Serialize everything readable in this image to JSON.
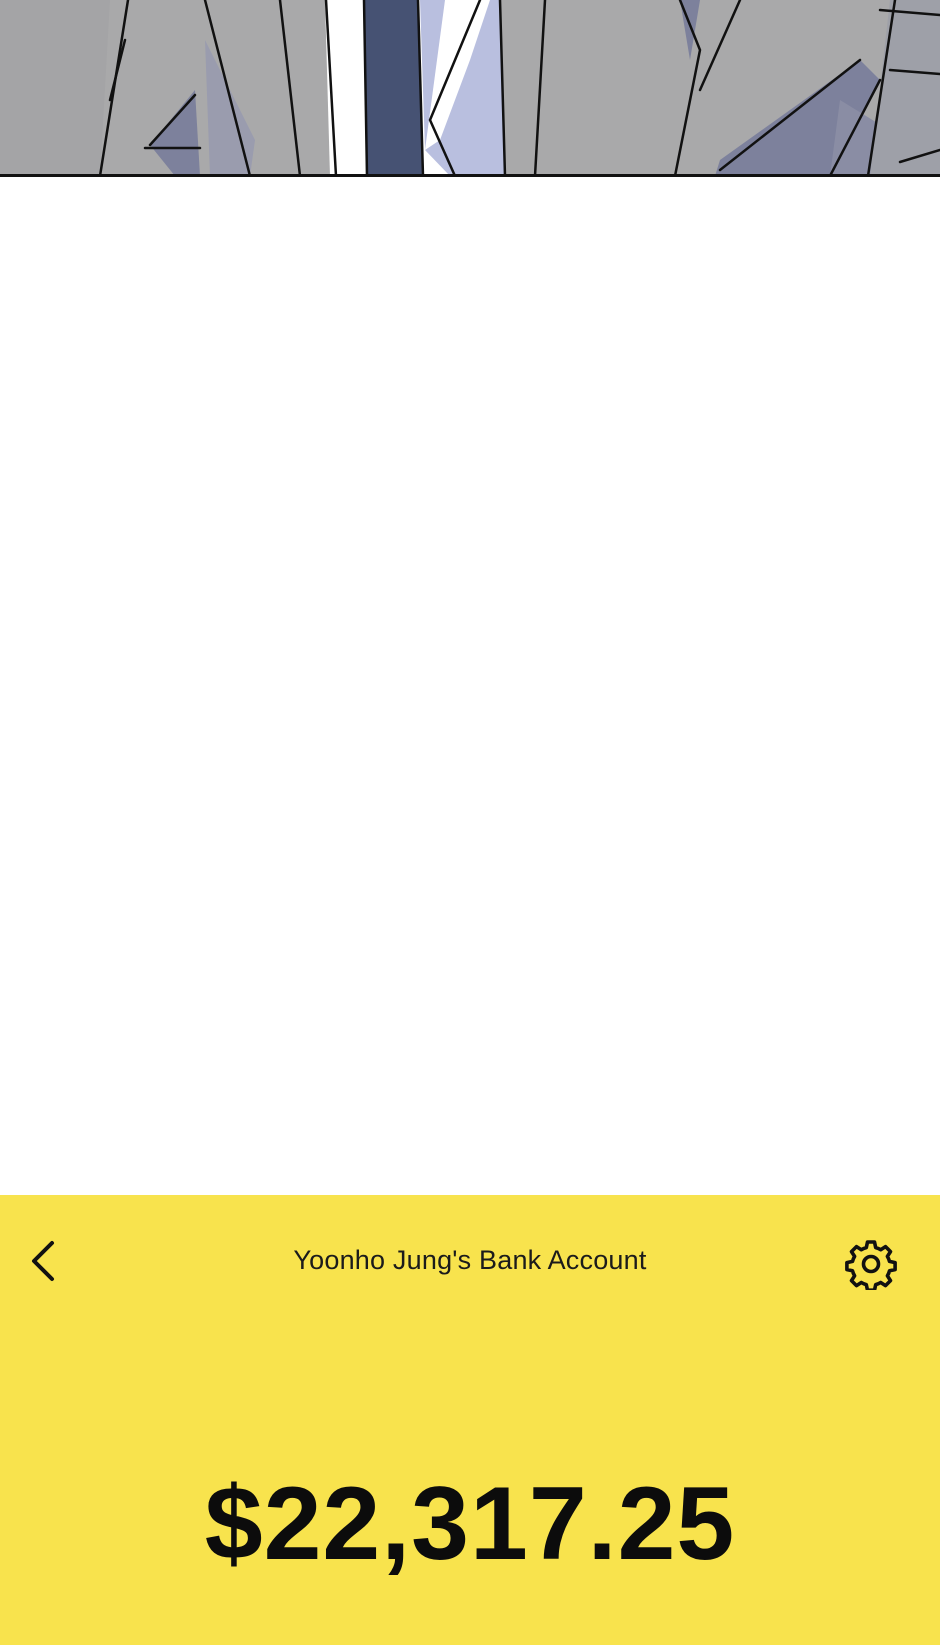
{
  "bank_app": {
    "title": "Yoonho Jung's Bank Account",
    "balance": "$22,317.25",
    "icons": {
      "back": "chevron-left-icon",
      "settings": "gear-icon"
    },
    "colors": {
      "screen_background": "#f8e34d",
      "text": "#1b1b1b"
    }
  },
  "illustration": {
    "colors": {
      "suit_gray": "#a9a9aa",
      "shadow_blue_gray": "#7d819c",
      "tie_navy": "#465273",
      "shirt_white": "#ffffff",
      "shirt_shade": "#b9bfdf"
    }
  }
}
